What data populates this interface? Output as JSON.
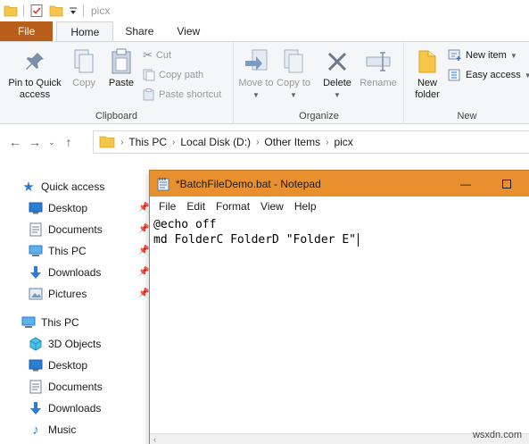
{
  "explorer": {
    "title": "picx",
    "tabs": [
      {
        "label": "File"
      },
      {
        "label": "Home"
      },
      {
        "label": "Share"
      },
      {
        "label": "View"
      }
    ],
    "ribbon": {
      "clipboard": {
        "label": "Clipboard",
        "pin_to_quick_access": "Pin to Quick access",
        "copy": "Copy",
        "paste": "Paste",
        "cut": "Cut",
        "copy_path": "Copy path",
        "paste_shortcut": "Paste shortcut"
      },
      "organize": {
        "label": "Organize",
        "move_to": "Move to",
        "copy_to": "Copy to",
        "delete": "Delete",
        "rename": "Rename"
      },
      "new": {
        "label": "New",
        "new_folder": "New folder",
        "new_item": "New item",
        "easy_access": "Easy access"
      }
    },
    "breadcrumb": [
      "This PC",
      "Local Disk (D:)",
      "Other Items",
      "picx"
    ],
    "nav": {
      "quick_access": "Quick access",
      "quick_items": [
        "Desktop",
        "Documents",
        "This PC",
        "Downloads",
        "Pictures"
      ],
      "this_pc": "This PC",
      "pc_items": [
        "3D Objects",
        "Desktop",
        "Documents",
        "Downloads",
        "Music"
      ]
    }
  },
  "notepad": {
    "title": "*BatchFileDemo.bat - Notepad",
    "menu": [
      "File",
      "Edit",
      "Format",
      "View",
      "Help"
    ],
    "content": "@echo off\nmd FolderC FolderD \"Folder E\""
  },
  "watermark": "wsxdn.com",
  "colors": {
    "file_tab": "#b85e1a",
    "notepad_titlebar": "#e9902e",
    "folder_yellow": "#f6c649",
    "blue_icon": "#2b7cd3"
  }
}
